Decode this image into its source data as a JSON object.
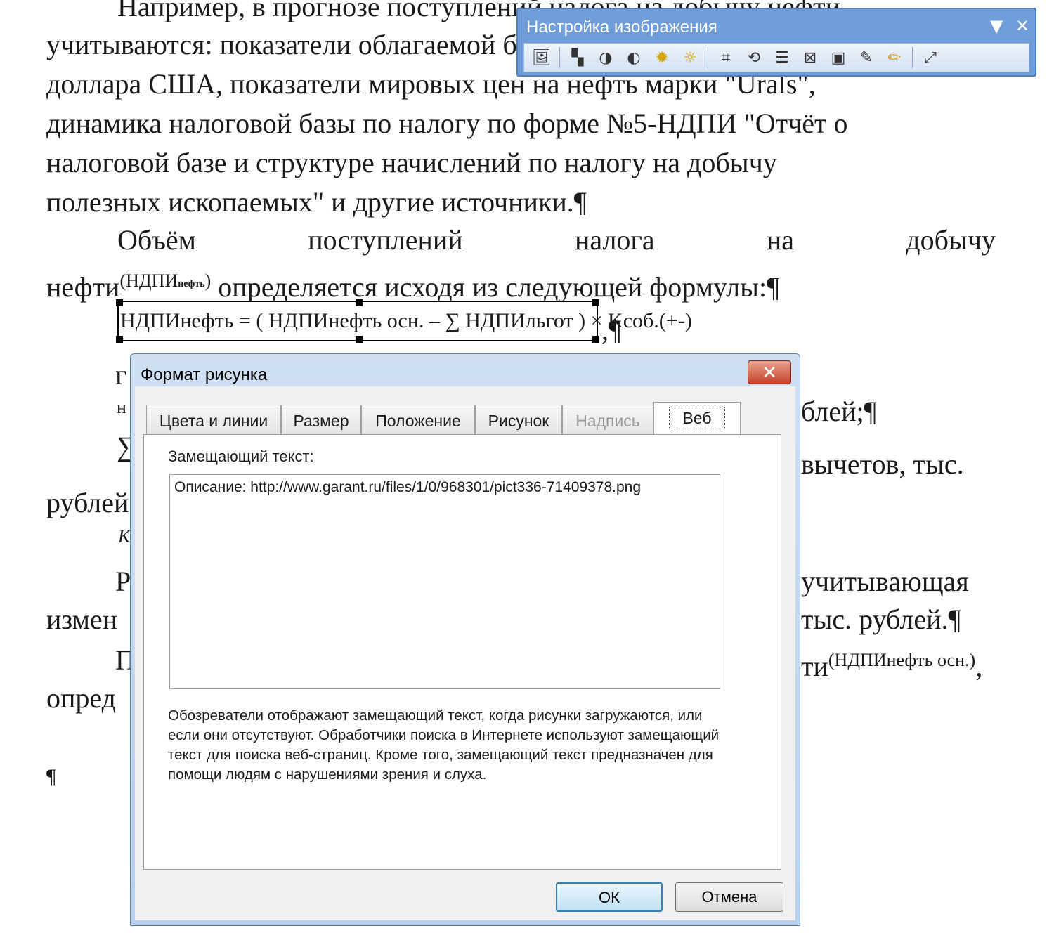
{
  "document": {
    "lines": [
      "Например, в прогнозе поступлений налога на добычу нефти",
      "учитываются: показатели облагаемой базы, курса",
      "доллара США, показатели мировых цен на нефть марки \"Urals\",",
      "динамика налоговой базы по налогу по форме №5-НДПИ \"Отчёт о",
      "налоговой базе и структуре начислений по налогу на добычу",
      "полезных ископаемых\" и другие источники.¶"
    ],
    "p2_words": [
      "Объём",
      "поступлений",
      "налога",
      "на",
      "добычу"
    ],
    "p2_line2_start": "нефти",
    "p2_line2_sup": "(НДПИ",
    "p2_line2_sub": "нефть",
    "p2_line2_sup_end": ")",
    "p2_line2_end": "определяется исходя из следующей формулы:¶",
    "formula_text": "НДПИнефть = ( НДПИнефть осн. – ∑ НДПИльгот ) × Kсоб.(+-)",
    "after_formula": ",¶",
    "fragments": {
      "l1_left": "г",
      "l2_left": "н",
      "l2_right": "блей;¶",
      "l3_left": "∑",
      "l3_right": "вычетов, тыс.",
      "l4_left": "рублей",
      "l5_left": "K",
      "l6_left": "Р",
      "l6_right": "учитывающая",
      "l7_left": "измен",
      "l7_right": "тыс. рублей.¶",
      "l8_left": "П",
      "l8_right": "ти",
      "l8_sup": "(НДПИнефть осн.)",
      "l8_end": ",",
      "l9_left": "опред",
      "pilcrow": "¶"
    }
  },
  "toolbar": {
    "title": "Настройка изображения",
    "buttons": [
      "insert-picture",
      "color",
      "more-contrast",
      "less-contrast",
      "more-brightness",
      "less-brightness",
      "crop",
      "rotate-left",
      "line-style",
      "compress-pictures",
      "text-wrapping",
      "format-picture",
      "set-transparent-color",
      "reset-picture"
    ]
  },
  "dialog": {
    "title": "Формат рисунка",
    "tabs": [
      {
        "label": "Цвета и линии",
        "state": "normal"
      },
      {
        "label": "Размер",
        "state": "normal"
      },
      {
        "label": "Положение",
        "state": "normal"
      },
      {
        "label": "Рисунок",
        "state": "normal"
      },
      {
        "label": "Надпись",
        "state": "disabled"
      },
      {
        "label": "Веб",
        "state": "active"
      }
    ],
    "alt_text_label": "Замещающий текст:",
    "alt_text_value": "Описание: http://www.garant.ru/files/1/0/968301/pict336-71409378.png",
    "help_text": "Обозреватели отображают замещающий текст, когда рисунки загружаются, или если они отсутствуют.  Обработчики поиска в Интернете используют замещающий текст для поиска веб-страниц. Кроме того, замещающий текст предназначен для помощи людям с нарушениями зрения и слуха.",
    "ok_label": "ОК",
    "cancel_label": "Отмена"
  }
}
